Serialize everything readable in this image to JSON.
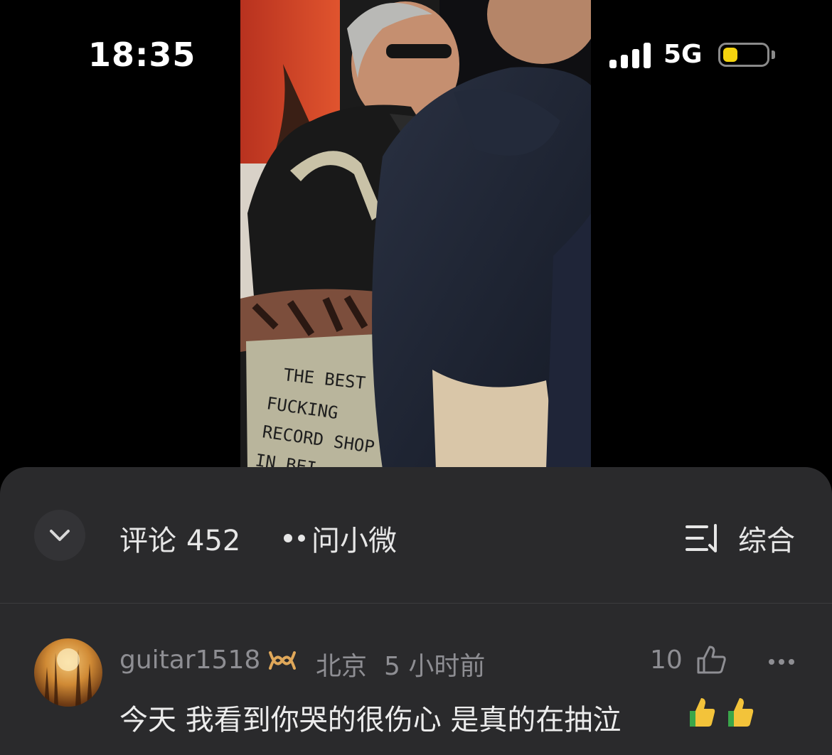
{
  "status_bar": {
    "time": "18:35",
    "network": "5G",
    "battery_level": 0.35,
    "battery_color": "#f5d40e"
  },
  "photo": {
    "tote_bag_text": [
      "THE BEST",
      "FUCKING",
      "RECORD SHOP",
      "IN BEI"
    ]
  },
  "comments_header": {
    "collapse_icon": "chevron-down-icon",
    "comments_label": "评论",
    "comments_count": "452",
    "ask_label": "问小微",
    "sort_icon": "sort-icon",
    "sort_label": "综合"
  },
  "comments": [
    {
      "username": "guitar1518",
      "badge_icon": "vip-badge-icon",
      "location": "北京",
      "time_ago": "5 小时前",
      "likes": "10",
      "text": "今天 我看到你哭的很伤心 是真的在抽泣",
      "emojis": [
        "thumbs-up-emoji",
        "thumbs-up-emoji"
      ]
    }
  ],
  "colors": {
    "sheet_background": "#2a2a2c",
    "muted_text": "#8e8e93",
    "vip_badge": "#e0a85a"
  }
}
